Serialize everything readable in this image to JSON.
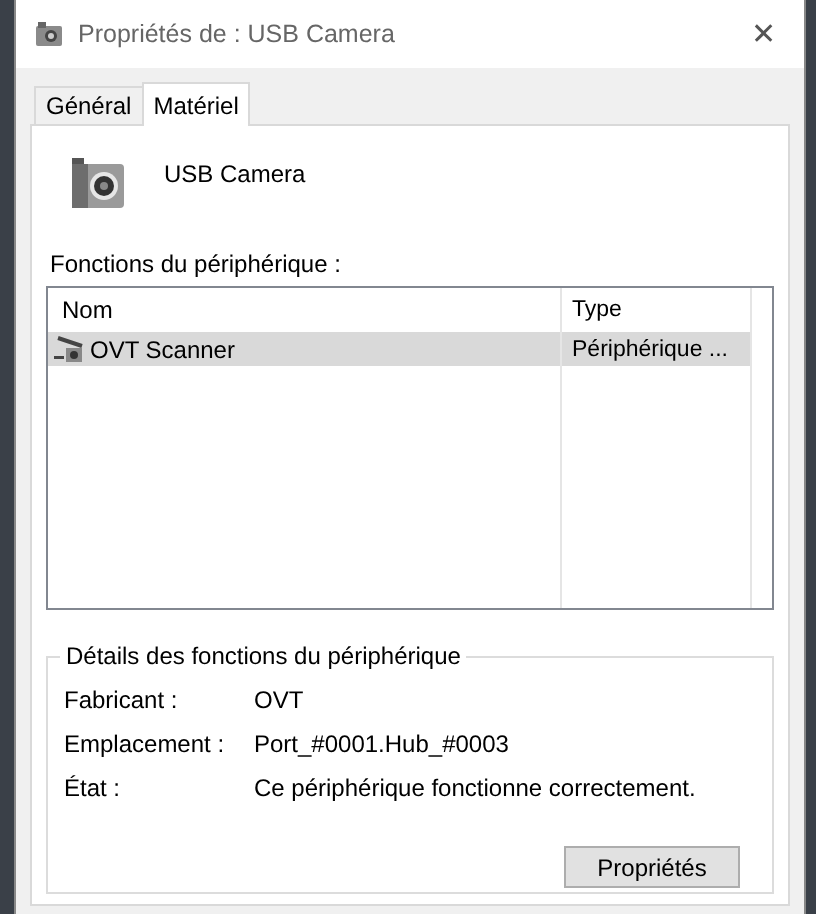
{
  "window": {
    "title": "Propriétés de : USB Camera",
    "close": "✕"
  },
  "tabs": [
    {
      "label": "Général",
      "selected": false
    },
    {
      "label": "Matériel",
      "selected": true
    }
  ],
  "device": {
    "name": "USB Camera"
  },
  "functions": {
    "label": "Fonctions du périphérique :",
    "columns": [
      "Nom",
      "Type"
    ],
    "rows": [
      {
        "name": "OVT Scanner",
        "type": "Périphérique ...",
        "selected": true
      }
    ]
  },
  "details": {
    "title": "Détails des fonctions du périphérique",
    "fields": [
      {
        "label": "Fabricant :",
        "value": "OVT"
      },
      {
        "label": "Emplacement :",
        "value": "Port_#0001.Hub_#0003"
      },
      {
        "label": "État :",
        "value": "Ce périphérique fonctionne correctement."
      }
    ],
    "button": "Propriétés"
  }
}
